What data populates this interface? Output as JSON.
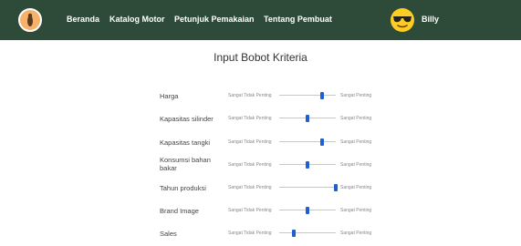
{
  "nav": {
    "items": [
      {
        "label": "Beranda"
      },
      {
        "label": "Katalog Motor"
      },
      {
        "label": "Petunjuk Pemakaian"
      },
      {
        "label": "Tentang Pembuat"
      }
    ],
    "user": {
      "name": "Billy"
    }
  },
  "page": {
    "title": "Input Bobot Kriteria"
  },
  "scale": {
    "left": "Sangat Tidak Penting",
    "right": "Sangat Penting"
  },
  "criteria": [
    {
      "label": "Harga",
      "value": 0.75
    },
    {
      "label": "Kapasitas silinder",
      "value": 0.5
    },
    {
      "label": "Kapasitas tangki",
      "value": 0.75
    },
    {
      "label": "Konsumsi bahan bakar",
      "value": 0.5
    },
    {
      "label": "Tahun produksi",
      "value": 1.0
    },
    {
      "label": "Brand Image",
      "value": 0.5
    },
    {
      "label": "Sales",
      "value": 0.25
    }
  ],
  "colors": {
    "navbar": "#2e4a38",
    "thumb": "#1f5fd1"
  },
  "icons": {
    "logo": "motorbike-logo-icon",
    "avatar": "sunglasses-emoji-icon"
  }
}
